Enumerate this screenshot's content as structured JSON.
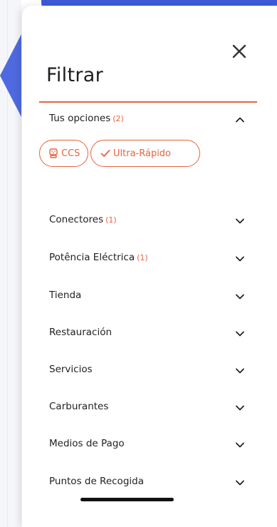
{
  "header": {
    "title": "Filtrar"
  },
  "icons": {
    "close": "close-icon",
    "chevron_up": "chevron-up-icon",
    "chevron_down": "chevron-down-icon",
    "plug": "plug-icon",
    "check": "check-icon"
  },
  "colors": {
    "accent": "#e8623f",
    "text": "#222222",
    "background_blue": "#3d5bd9"
  },
  "options": {
    "label": "Tus opciones",
    "count": "(2)",
    "expanded": true,
    "chips": [
      {
        "label": "CCS",
        "icon": "plug-icon"
      },
      {
        "label": "Ultra-Rápido",
        "icon": "check-icon"
      }
    ]
  },
  "sections": [
    {
      "label": "Conectores",
      "count": "(1)"
    },
    {
      "label": "Potência Eléctrica",
      "count": "(1)"
    },
    {
      "label": "Tienda",
      "count": ""
    },
    {
      "label": "Restauración",
      "count": ""
    },
    {
      "label": "Servicios",
      "count": ""
    },
    {
      "label": "Carburantes",
      "count": ""
    },
    {
      "label": "Medios de Pago",
      "count": ""
    },
    {
      "label": "Puntos de Recogida",
      "count": ""
    }
  ]
}
